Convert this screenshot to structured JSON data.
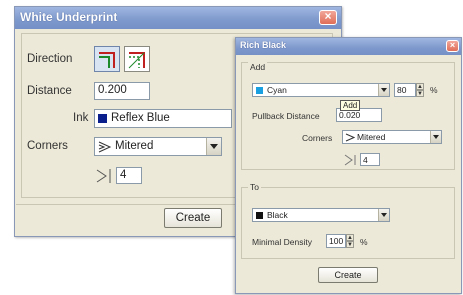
{
  "white_underprint": {
    "title": "White Underprint",
    "direction_label": "Direction",
    "distance_label": "Distance",
    "distance_value": "0.200",
    "ink_label": "Ink",
    "ink_value": "Reflex Blue",
    "ink_color": "#0a1e8c",
    "corners_label": "Corners",
    "corners_value": "Mitered",
    "corner_value": "4",
    "create_label": "Create"
  },
  "rich_black": {
    "title": "Rich Black",
    "add_group": "Add",
    "add_ink_value": "Cyan",
    "add_ink_color": "#1aa0e0",
    "add_percent_value": "80",
    "percent_symbol": "%",
    "tooltip": "Add",
    "pullback_label": "Pullback Distance",
    "pullback_value": "0.020",
    "corners_label": "Corners",
    "corners_value": "Mitered",
    "corner_value": "4",
    "to_group": "To",
    "to_ink_value": "Black",
    "to_ink_color": "#111111",
    "min_density_label": "Minimal Density",
    "min_density_value": "100",
    "min_density_unit": "%",
    "create_label": "Create"
  }
}
